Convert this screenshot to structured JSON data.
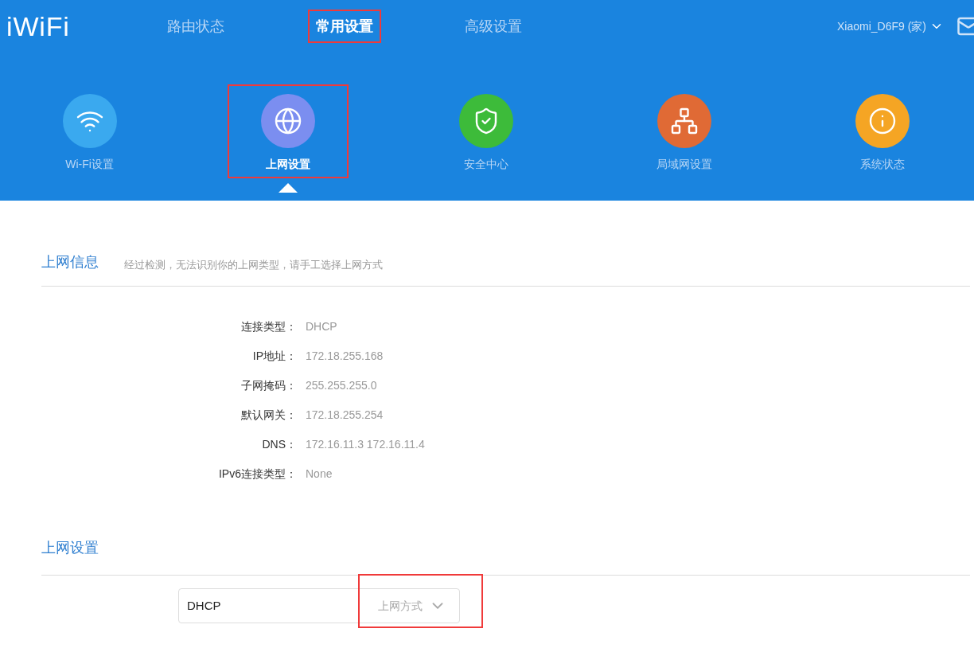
{
  "header": {
    "logo": "iWiFi",
    "tabs": [
      {
        "label": "路由状态",
        "selected": false,
        "highlighted": false
      },
      {
        "label": "常用设置",
        "selected": true,
        "highlighted": true
      },
      {
        "label": "高级设置",
        "selected": false,
        "highlighted": false
      }
    ],
    "account": "Xiaomi_D6F9 (家)"
  },
  "nav": [
    {
      "kind": "wifi",
      "label": "Wi-Fi设置",
      "color": "#3aa9ef",
      "selected": false,
      "highlighted": false
    },
    {
      "kind": "globe",
      "label": "上网设置",
      "color": "#7b8ef0",
      "selected": true,
      "highlighted": true
    },
    {
      "kind": "shield",
      "label": "安全中心",
      "color": "#3dbb3a",
      "selected": false,
      "highlighted": false
    },
    {
      "kind": "network",
      "label": "局域网设置",
      "color": "#e06a35",
      "selected": false,
      "highlighted": false
    },
    {
      "kind": "info",
      "label": "系统状态",
      "color": "#f5a524",
      "selected": false,
      "highlighted": false
    }
  ],
  "info_section": {
    "title": "上网信息",
    "hint": "经过检测，无法识别你的上网类型，请手工选择上网方式",
    "rows": [
      {
        "label": "连接类型：",
        "value": "DHCP"
      },
      {
        "label": "IP地址：",
        "value": "172.18.255.168"
      },
      {
        "label": "子网掩码：",
        "value": "255.255.255.0"
      },
      {
        "label": "默认网关：",
        "value": "172.18.255.254"
      },
      {
        "label": "DNS：",
        "value": "172.16.11.3 172.16.11.4"
      },
      {
        "label": "IPv6连接类型：",
        "value": "None"
      }
    ]
  },
  "settings_section": {
    "title": "上网设置",
    "select": {
      "value": "DHCP",
      "label": "上网方式",
      "highlighted": true
    }
  }
}
